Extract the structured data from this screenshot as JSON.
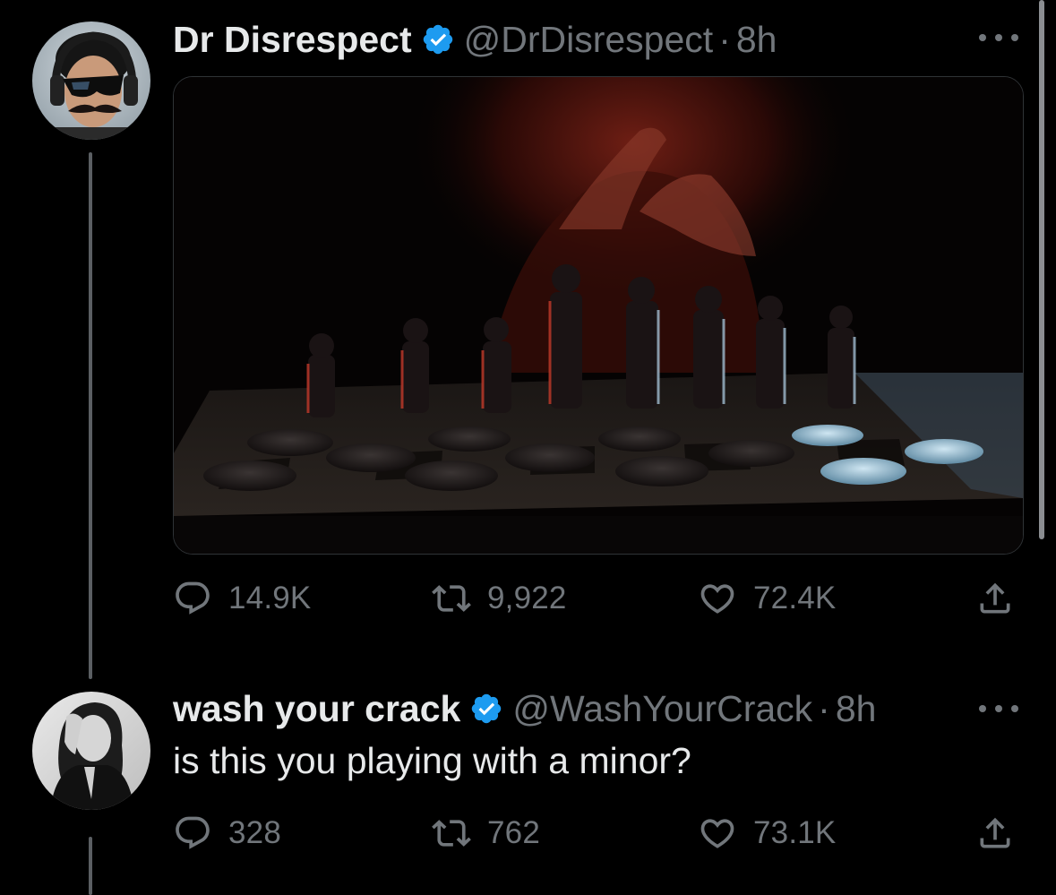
{
  "tweets": [
    {
      "display_name": "Dr Disrespect",
      "verified": true,
      "handle": "@DrDisrespect",
      "separator": "·",
      "time": "8h",
      "text": "",
      "media": "chessboard-photo",
      "stats": {
        "replies": "14.9K",
        "retweets": "9,922",
        "likes": "72.4K"
      }
    },
    {
      "display_name": "wash your crack",
      "verified": true,
      "handle": "@WashYourCrack",
      "separator": "·",
      "time": "8h",
      "text": "is this you playing with a minor?",
      "stats": {
        "replies": "328",
        "retweets": "762",
        "likes": "73.1K"
      }
    }
  ],
  "colors": {
    "background": "#000000",
    "primary_text": "#e7e9ea",
    "secondary_text": "#71767b",
    "verified_badge": "#1d9bf0",
    "thread_line": "#5b5f63"
  },
  "icons": [
    "verified-badge-icon",
    "more-options-icon",
    "reply-icon",
    "retweet-icon",
    "like-icon",
    "share-icon"
  ]
}
